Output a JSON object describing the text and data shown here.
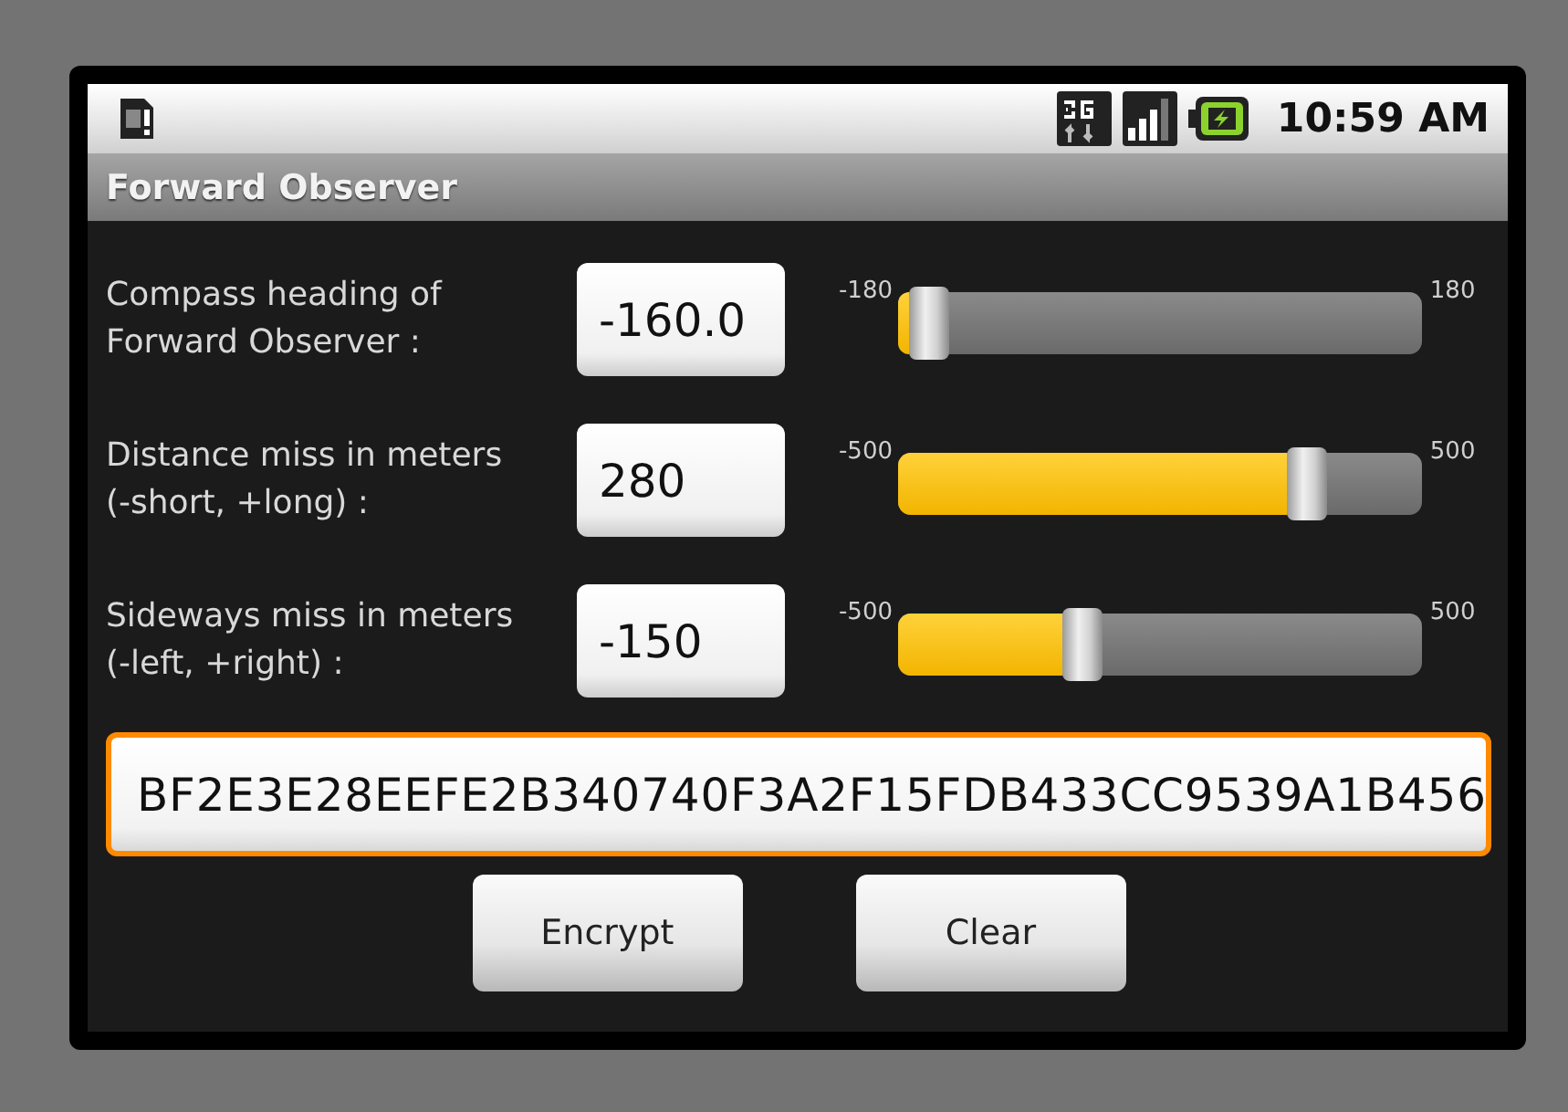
{
  "status_bar": {
    "time": "10:59 AM"
  },
  "window": {
    "title": "Forward Observer"
  },
  "rows": [
    {
      "label": "Compass heading of Forward Observer :",
      "value": "-160.0",
      "min": "-180",
      "max": "180",
      "level": 0.06
    },
    {
      "label": "Distance miss in meters (-short, +long) :",
      "value": "280",
      "min": "-500",
      "max": "500",
      "level": 0.78
    },
    {
      "label": "Sideways miss in meters (-left, +right) :",
      "value": "-150",
      "min": "-500",
      "max": "500",
      "level": 0.35
    }
  ],
  "cipher_field": {
    "value": "BF2E3E28EEFE2B340740F3A2F15FDB433CC9539A1B456",
    "focused": true
  },
  "buttons": [
    {
      "label": "Encrypt"
    },
    {
      "label": "Clear"
    }
  ]
}
